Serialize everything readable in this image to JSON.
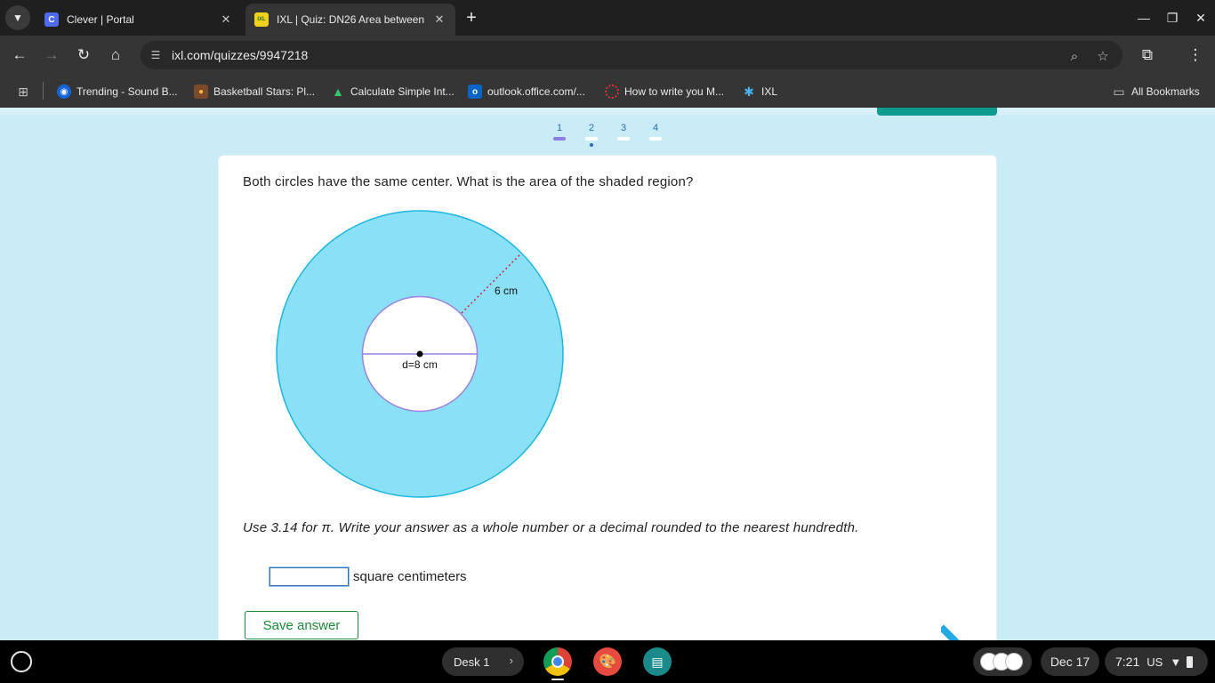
{
  "browser": {
    "tabs": [
      {
        "title": "Clever | Portal",
        "favicon_letter": "C",
        "active": false
      },
      {
        "title": "IXL | Quiz: DN26 Area between",
        "favicon_letter": "IXL",
        "active": true
      }
    ],
    "new_tab_symbol": "+",
    "url": "ixl.com/quizzes/9947218",
    "bookmarks": [
      {
        "label": "Trending - Sound B...",
        "icon": "soundcloud-icon"
      },
      {
        "label": "Basketball Stars: Pl...",
        "icon": "game-icon"
      },
      {
        "label": "Calculate Simple Int...",
        "icon": "calculator-icon"
      },
      {
        "label": "outlook.office.com/...",
        "icon": "outlook-icon"
      },
      {
        "label": "How to write you M...",
        "icon": "dotted-circle-icon"
      },
      {
        "label": "IXL",
        "icon": "ixl-icon"
      }
    ],
    "all_bookmarks_label": "All Bookmarks"
  },
  "quiz": {
    "question_numbers": [
      "1",
      "2",
      "3",
      "4"
    ],
    "current_question": 1,
    "question_text": "Both circles have the same center. What is the area of the shaded region?",
    "diagram": {
      "outer_label": "6 cm",
      "inner_label": "d=8 cm",
      "colors": {
        "shaded": "#8ae0f7",
        "outer_stroke": "#1cb6e0",
        "inner_stroke": "#9b82e0",
        "radius_line": "#d4243c"
      }
    },
    "instructions": "Use 3.14 for π. Write your answer as a whole number or a decimal rounded to the nearest hundredth.",
    "answer_value": "",
    "unit_label": "square centimeters",
    "save_button_label": "Save answer"
  },
  "shelf": {
    "desk_label": "Desk 1",
    "date": "Dec 17",
    "time": "7:21",
    "locale": "US",
    "apps": [
      "chrome-icon",
      "paint-icon",
      "classroom-icon"
    ]
  }
}
